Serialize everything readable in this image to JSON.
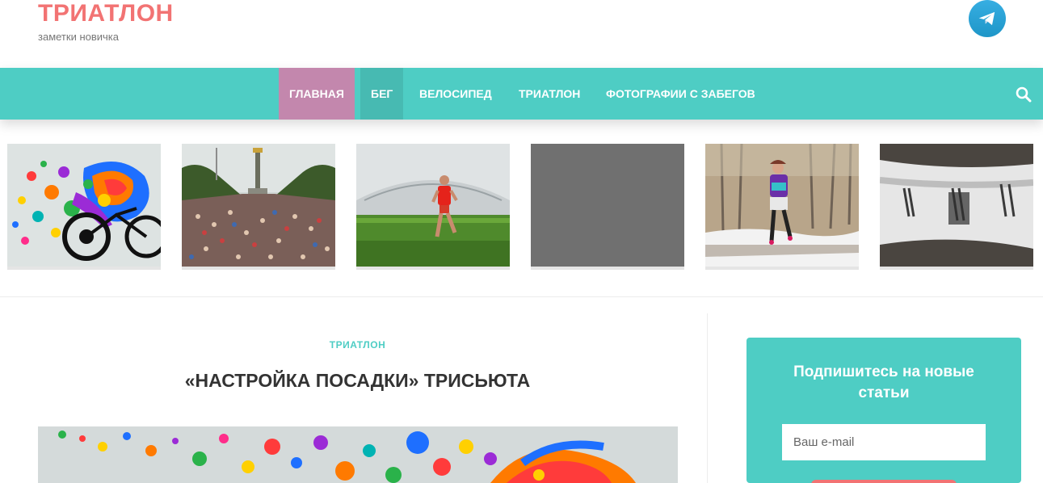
{
  "header": {
    "site_title": "ТРИАТЛОН",
    "tagline": "заметки новичка",
    "social_icon": "telegram-icon"
  },
  "nav": {
    "items": [
      {
        "label": "ГЛАВНАЯ",
        "state": "active"
      },
      {
        "label": "БЕГ",
        "state": "hover"
      },
      {
        "label": "ВЕЛОСИПЕД",
        "state": "normal"
      },
      {
        "label": "ТРИАТЛОН",
        "state": "normal"
      },
      {
        "label": "ФОТОГРАФИИ С ЗАБЕГОВ",
        "state": "normal"
      }
    ],
    "search_icon": "search-icon"
  },
  "thumbnails": [
    {
      "subject": "colorful-cyclist-art"
    },
    {
      "subject": "marathon-crowd"
    },
    {
      "subject": "runner-red-shirt"
    },
    {
      "subject": "placeholder-gray"
    },
    {
      "subject": "runner-in-snow"
    },
    {
      "subject": "bicycle-frame-closeup"
    }
  ],
  "post": {
    "category": "ТРИАТЛОН",
    "title": "«НАСТРОЙКА ПОСАДКИ» ТРИСЬЮТА"
  },
  "sidebar": {
    "subscribe_title": "Подпишитесь на новые статьи",
    "email_placeholder": "Ваш e-mail"
  },
  "colors": {
    "brand_red": "#f27373",
    "nav_teal": "#4ecdc4",
    "active_pink": "#c387ad"
  }
}
